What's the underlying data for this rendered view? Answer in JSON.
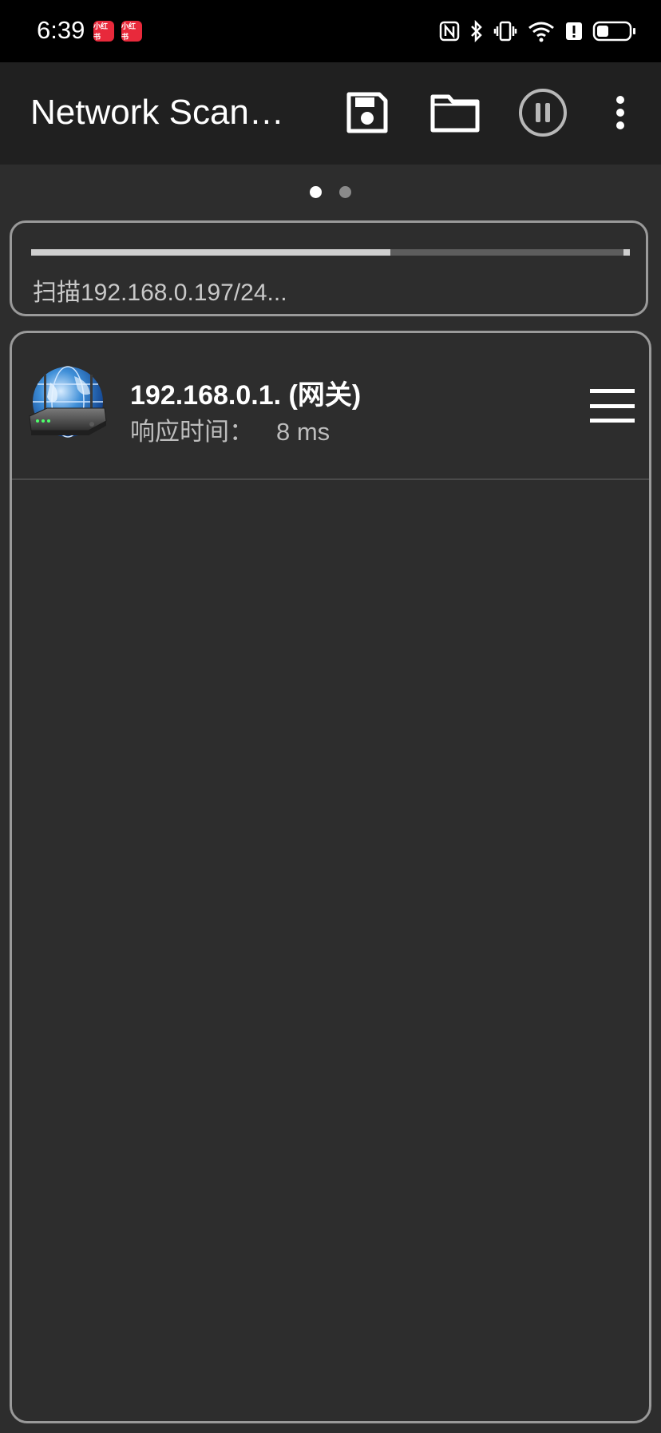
{
  "status_bar": {
    "time": "6:39",
    "notification_badges": [
      "小红书",
      "小红书"
    ],
    "battery_level": 0.3
  },
  "app_bar": {
    "title": "Network Scan…",
    "actions": [
      "save-icon",
      "folder-icon",
      "pause-icon",
      "more-vert-icon"
    ]
  },
  "pager": {
    "pages": 2,
    "active": 0
  },
  "scan": {
    "progress": 0.6,
    "status_text": "扫描192.168.0.197/24..."
  },
  "devices": [
    {
      "name": "192.168.0.1. (网关)",
      "response_label": "响应时间：",
      "response_value": "8 ms",
      "icon": "router-globe-icon",
      "menu_icon": "hamburger-menu-icon"
    }
  ],
  "colors": {
    "background": "#2d2d2d",
    "app_bar": "#202020",
    "card_border": "#9a9a9a",
    "progress_fill": "#cfcfcf",
    "badge_red": "#e8293b"
  }
}
